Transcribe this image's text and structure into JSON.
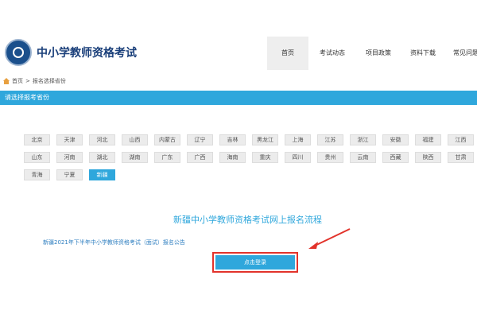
{
  "header": {
    "site_title": "中小学教师资格考试",
    "nav": [
      "首页",
      "考试动态",
      "项目政策",
      "资料下载",
      "常见问题"
    ]
  },
  "breadcrumb": {
    "home": "首页",
    "separator": ">",
    "current": "报名选择省份"
  },
  "bar_title": "请选择报考省份",
  "provinces": [
    [
      "北京",
      "天津",
      "河北",
      "山西",
      "内蒙古",
      "辽宁",
      "吉林",
      "黑龙江",
      "上海",
      "江苏",
      "浙江",
      "安徽",
      "福建",
      "江西"
    ],
    [
      "山东",
      "河南",
      "湖北",
      "湖南",
      "广东",
      "广西",
      "海南",
      "重庆",
      "四川",
      "贵州",
      "云南",
      "西藏",
      "陕西",
      "甘肃"
    ],
    [
      "青海",
      "宁夏",
      "新疆"
    ]
  ],
  "selected_province": "新疆",
  "section_heading": "新疆中小学教师资格考试网上报名流程",
  "notice_link": "新疆2021年下半年中小学教师资格考试（面试）报名公告",
  "login_button": "点击登录",
  "colors": {
    "accent": "#2fa7dc",
    "highlight": "#e2332b",
    "title": "#1a3f7a"
  },
  "icons": {
    "logo": "seal-logo-icon",
    "home": "home-icon",
    "annotation": "red-arrow-icon"
  }
}
